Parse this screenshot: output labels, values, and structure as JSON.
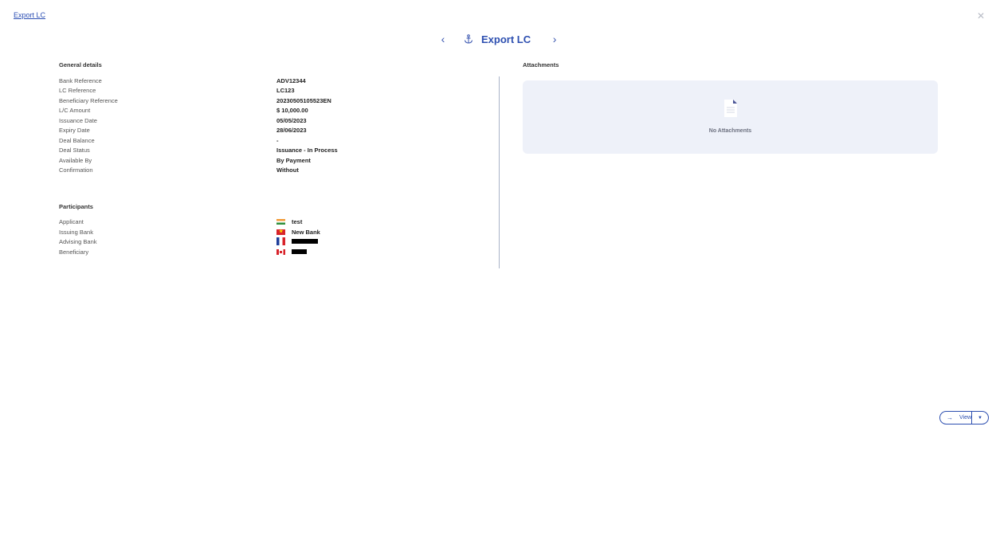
{
  "breadcrumb": "Export LC",
  "header": {
    "title": "Export LC"
  },
  "general": {
    "title": "General details",
    "rows": [
      {
        "label": "Bank Reference",
        "value": "ADV12344"
      },
      {
        "label": "LC Reference",
        "value": "LC123"
      },
      {
        "label": "Beneficiary Reference",
        "value": "20230505105523EN"
      },
      {
        "label": "L/C Amount",
        "value": "$ 10,000.00"
      },
      {
        "label": "Issuance Date",
        "value": "05/05/2023"
      },
      {
        "label": "Expiry Date",
        "value": "28/06/2023"
      },
      {
        "label": "Deal Balance",
        "value": "-"
      },
      {
        "label": "Deal Status",
        "value": "Issuance - In Process"
      },
      {
        "label": "Available By",
        "value": "By Payment"
      },
      {
        "label": "Confirmation",
        "value": "Without"
      }
    ]
  },
  "participants": {
    "title": "Participants",
    "rows": [
      {
        "label": "Applicant",
        "value": "test",
        "flag": "india-flag-icon"
      },
      {
        "label": "Issuing Bank",
        "value": "New Bank",
        "flag": "vietnam-flag-icon"
      },
      {
        "label": "Advising Bank",
        "value": "",
        "flag": "france-flag-icon"
      },
      {
        "label": "Beneficiary",
        "value": "",
        "flag": "canada-flag-icon"
      }
    ]
  },
  "attachments": {
    "title": "Attachments",
    "empty_text": "No Attachments"
  },
  "actions": {
    "view_label": "View"
  },
  "colors": {
    "accent": "#2d4fb0",
    "panel": "#eef1f9"
  }
}
